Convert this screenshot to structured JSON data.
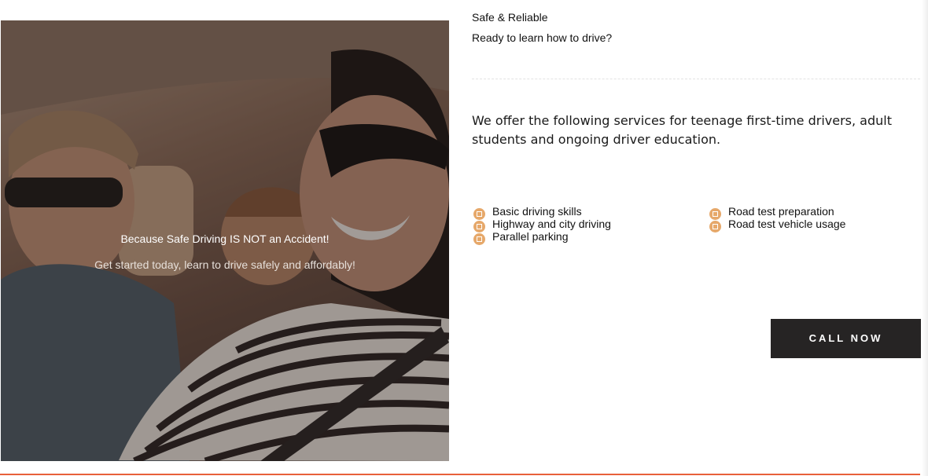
{
  "hero": {
    "tagline": "Because Safe Driving IS NOT an Accident!",
    "subtext": "Get started today, learn to drive safely and affordably!"
  },
  "header": {
    "eyebrow": "Safe & Reliable",
    "lead": "Ready to learn how to drive?"
  },
  "intro": "We offer the following services for teenage first-time drivers, adult students and ongoing driver education.",
  "services": {
    "left": [
      "Basic driving skills",
      "Highway and city driving",
      "Parallel parking"
    ],
    "right": [
      "Road test preparation",
      "Road test vehicle usage"
    ],
    "bullet_color": "#e6a86a"
  },
  "cta": {
    "label": "CALL NOW"
  },
  "colors": {
    "accent_rule": "#e8603a",
    "button_bg": "#262424"
  }
}
